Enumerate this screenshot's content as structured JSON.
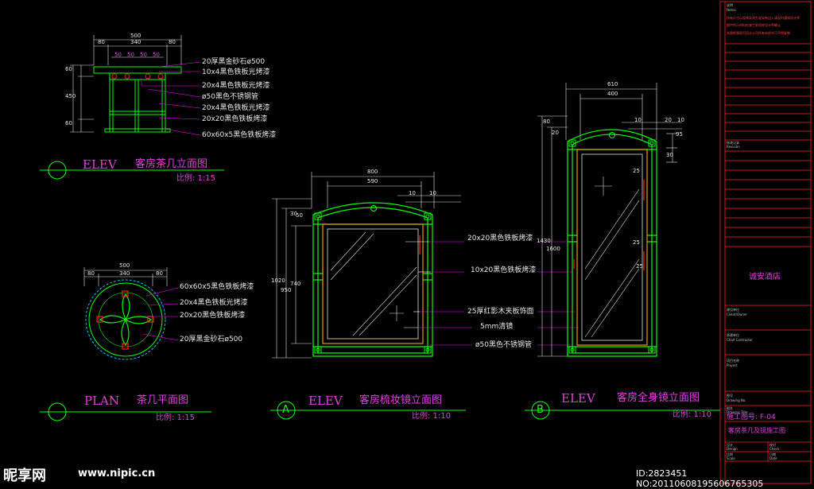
{
  "colors": {
    "background": "#000000",
    "outline": "#00ff00",
    "inner_frame": "#e0a000",
    "glass": "#e0e0e0",
    "dimension": "#e8e8e8",
    "leader": "#ff00ff",
    "title_text": "#e040e0",
    "accent_red": "#ff2020",
    "plan_circle": "#00c0ff"
  },
  "tea_table_elev": {
    "dims_top": [
      "500",
      "340",
      "80",
      "80"
    ],
    "dims_sub": [
      "50",
      "50",
      "50",
      "50"
    ],
    "dims_left": [
      "60",
      "450",
      "60"
    ],
    "notes": [
      "20厚黑金砂石ø500",
      "10x4黑色铁板光烤漆",
      "20x4黑色铁板光烤漆",
      "ø50黑色不锈钢管",
      "20x4黑色铁板光烤漆",
      "20x20黑色铁板烤漆",
      "60x60x5黑色铁板烤漆"
    ],
    "title_tag": "ELEV",
    "title": "客房茶几立面图",
    "scale": "比例: 1:15"
  },
  "tea_table_plan": {
    "dims_top": [
      "500",
      "80",
      "340",
      "80"
    ],
    "notes": [
      "60x60x5黑色铁板烤漆",
      "20x4黑色铁板光烤漆",
      "20x20黑色铁板烤漆",
      "20厚黑金砂石ø500"
    ],
    "title_tag": "PLAN",
    "title": "茶几平面图",
    "scale": "比例: 1:15"
  },
  "dressing_mirror": {
    "dims_top": [
      "800",
      "590",
      "10",
      "10"
    ],
    "dims_left": [
      "1020",
      "950",
      "740",
      "30",
      "50"
    ],
    "notes": [
      "20x20黑色铁板烤漆",
      "10x20黑色铁板烤漆",
      "25厚红影木夹板饰面",
      "5mm清镜",
      "ø50黑色不锈钢管"
    ],
    "marker": "A",
    "title_tag": "ELEV",
    "title": "客房梳妆镜立面图",
    "scale": "比例: 1:10"
  },
  "full_mirror": {
    "dims_top": [
      "610",
      "400",
      "10",
      "20",
      "10"
    ],
    "dims_left": [
      "1430",
      "1600",
      "80",
      "20"
    ],
    "dims_right": [
      "95",
      "30",
      "25",
      "25",
      "25"
    ],
    "marker": "B",
    "title_tag": "ELEV",
    "title": "客房全身镜立面图",
    "scale": "比例: 1:10"
  },
  "title_block": {
    "header_lines": [
      "说明",
      "Notes"
    ],
    "red_notes": [
      "所有尺寸以现场实测为准如有出入请及时通知设计师",
      "图中所示材料在施工前须经设计师确认",
      "本图纸版权归设计公司所有未经许可不得复制"
    ],
    "revision_label": [
      "修改记录",
      "Revision"
    ],
    "hotel_name": "诚安酒店",
    "owner_label": [
      "建设单位",
      "Client/Owner"
    ],
    "contractor_label": [
      "承建单位",
      "Chief Contractor"
    ],
    "project_label": [
      "项目名称",
      "Project"
    ],
    "drawing_no_label": [
      "图号",
      "Drawing No."
    ],
    "drawing_title_label": [
      "图名",
      "Drawing Title"
    ],
    "drawing_no": "施工图号: F-04",
    "drawing_title": "客房茶几及镜施工图",
    "bottom_labels": [
      "设计",
      "Design",
      "校对",
      "Check",
      "比例",
      "Scale",
      "日期",
      "Date"
    ]
  },
  "watermark": {
    "logo": "昵享网",
    "url": "www.nipic.cn",
    "id_text": "ID:2823451 NO:20110608195606765305"
  }
}
